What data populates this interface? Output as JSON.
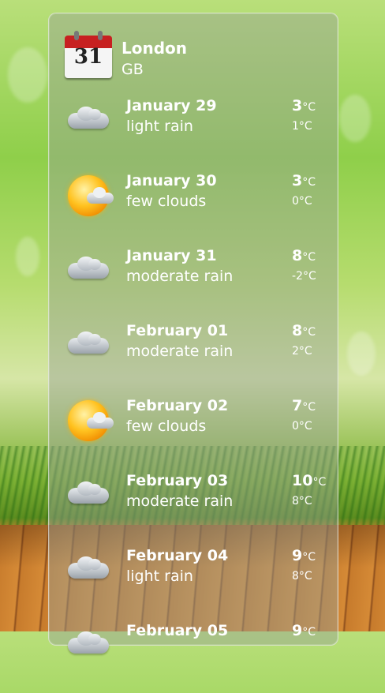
{
  "location": {
    "city": "London",
    "country": "GB"
  },
  "calendar": {
    "day_number": "31"
  },
  "forecast": [
    {
      "date": "January 29",
      "description": "light rain",
      "high": "3",
      "low": "1°C",
      "unit": "°C",
      "icon": "rain-cloud-icon"
    },
    {
      "date": "January 30",
      "description": "few clouds",
      "high": "3",
      "low": "0°C",
      "unit": "°C",
      "icon": "sun-cloud-icon"
    },
    {
      "date": "January 31",
      "description": "moderate rain",
      "high": "8",
      "low": "-2°C",
      "unit": "°C",
      "icon": "rain-cloud-icon"
    },
    {
      "date": "February 01",
      "description": "moderate rain",
      "high": "8",
      "low": "2°C",
      "unit": "°C",
      "icon": "rain-cloud-icon"
    },
    {
      "date": "February 02",
      "description": "few clouds",
      "high": "7",
      "low": "0°C",
      "unit": "°C",
      "icon": "sun-cloud-icon"
    },
    {
      "date": "February 03",
      "description": "moderate rain",
      "high": "10",
      "low": "8°C",
      "unit": "°C",
      "icon": "rain-cloud-icon"
    },
    {
      "date": "February 04",
      "description": "light rain",
      "high": "9",
      "low": "8°C",
      "unit": "°C",
      "icon": "rain-cloud-icon"
    },
    {
      "date": "February 05",
      "description": "",
      "high": "9",
      "low": "",
      "unit": "°C",
      "icon": "rain-cloud-icon"
    }
  ]
}
